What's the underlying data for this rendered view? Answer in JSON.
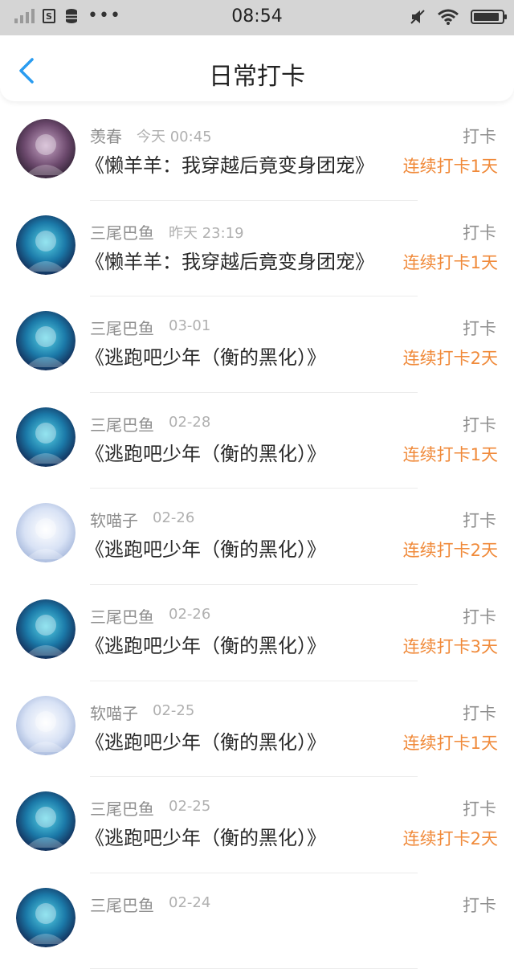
{
  "status_bar": {
    "time": "08:54",
    "icons": [
      "signal-icon",
      "s-box-icon",
      "database-icon",
      "more-dots-icon",
      "mute-icon",
      "wifi-icon",
      "battery-icon"
    ],
    "battery_level": 0.92
  },
  "nav": {
    "title": "日常打卡",
    "back_icon": "chevron-left-icon",
    "accent_color": "#2a9cf0"
  },
  "colors": {
    "streak": "#f08a3a",
    "secondary_text": "#8e8e8e",
    "time_text": "#b0b0b0"
  },
  "items": [
    {
      "user": "羡春",
      "time": "今天 00:45",
      "book": "《懒羊羊：我穿越后竟变身团宠》",
      "action": "打卡",
      "streak": "连续打卡1天",
      "avatar": "dark-avatar"
    },
    {
      "user": "三尾巴鱼",
      "time": "昨天 23:19",
      "book": "《懒羊羊：我穿越后竟变身团宠》",
      "action": "打卡",
      "streak": "连续打卡1天",
      "avatar": "blue-avatar"
    },
    {
      "user": "三尾巴鱼",
      "time": "03-01",
      "book": "《逃跑吧少年（衡的黑化）》",
      "action": "打卡",
      "streak": "连续打卡2天",
      "avatar": "blue-avatar"
    },
    {
      "user": "三尾巴鱼",
      "time": "02-28",
      "book": "《逃跑吧少年（衡的黑化）》",
      "action": "打卡",
      "streak": "连续打卡1天",
      "avatar": "blue-avatar"
    },
    {
      "user": "软喵子",
      "time": "02-26",
      "book": "《逃跑吧少年（衡的黑化）》",
      "action": "打卡",
      "streak": "连续打卡2天",
      "avatar": "light-avatar"
    },
    {
      "user": "三尾巴鱼",
      "time": "02-26",
      "book": "《逃跑吧少年（衡的黑化）》",
      "action": "打卡",
      "streak": "连续打卡3天",
      "avatar": "blue-avatar"
    },
    {
      "user": "软喵子",
      "time": "02-25",
      "book": "《逃跑吧少年（衡的黑化）》",
      "action": "打卡",
      "streak": "连续打卡1天",
      "avatar": "light-avatar"
    },
    {
      "user": "三尾巴鱼",
      "time": "02-25",
      "book": "《逃跑吧少年（衡的黑化）》",
      "action": "打卡",
      "streak": "连续打卡2天",
      "avatar": "blue-avatar"
    },
    {
      "user": "三尾巴鱼",
      "time": "02-24",
      "book": "",
      "action": "打卡",
      "streak": "",
      "avatar": "blue-avatar"
    }
  ]
}
